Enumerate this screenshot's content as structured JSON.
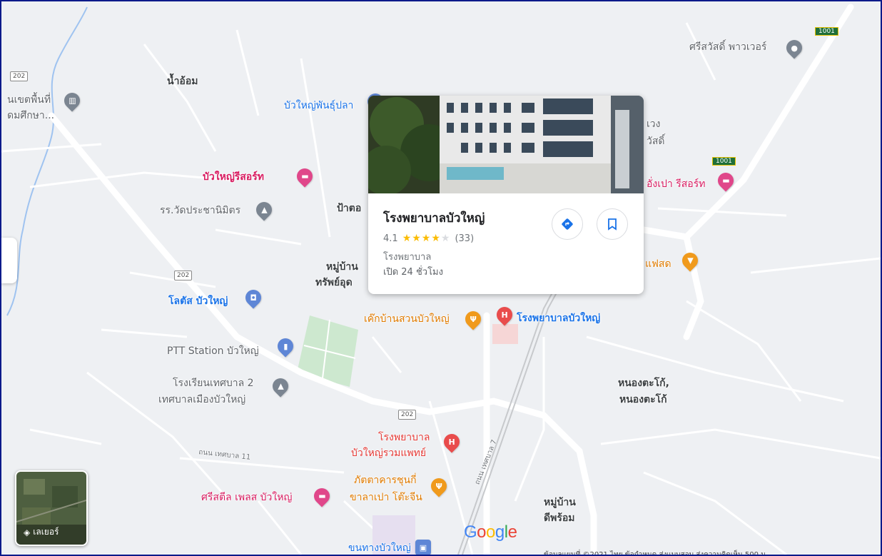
{
  "place_card": {
    "name": "โรงพยาบาลบัวใหญ่",
    "rating": "4.1",
    "rating_value": 4.1,
    "review_count": "(33)",
    "category": "โรงพยาบาล",
    "hours": "เปิด 24 ชั่วโมง",
    "directions_icon": "directions-icon",
    "save_icon": "bookmark-icon"
  },
  "labels": {
    "namom": "น้ำอ้อม",
    "sri_power": "ศรีสวัสดิ์ พาวเวอร์",
    "bua_yai_fish": "บัวใหญ่พันธุ์ปลา",
    "museum_line1": "นเขตพื้นที่",
    "museum_line2": "ดมศึกษา...",
    "resort": "บัวใหญ่รีสอร์ท",
    "school": "รร.วัดประชานิมิตร",
    "pata": "ป้าตอ",
    "village1_line1": "หมู่บ้าน",
    "village1_line2": "ทรัพย์อุด",
    "lotus": "โลตัส บัวใหญ่",
    "ptt": "PTT Station บัวใหญ่",
    "muni_school_line1": "โรงเรียนเทศบาล 2",
    "muni_school_line2": "เทศบาลเมืองบัวใหญ่",
    "suan_food": "เค๊กบ้านสวนบัวใหญ่",
    "hospital_map": "โรงพยาบาลบัวใหญ่",
    "hosp2_line1": "โรงพยาบาล",
    "hosp2_line2": "บัวใหญ่รวมแพทย์",
    "road_thesaban11": "ถนน เทศบาล 11",
    "restaurant_line1": "ภัตตาคารชุนกี่",
    "restaurant_line2": "ขาลาเปา โต๊ะจีน",
    "srisatin": "ศรีสตีล เพลส บัวใหญ่",
    "bus": "ขนทางบัวใหญ่",
    "village2_line1": "หมู่บ้าน",
    "village2_line2": "ดีพร้อม",
    "nongtako_line1": "หนองตะโก้,",
    "nongtako_line2": "หนองตะโก้",
    "aungpao": "อั่งเปา รีสอร์ท",
    "cafe": "แฟสด",
    "guang_line1": "เวง",
    "guang_line2": "วัสดิ์",
    "road_thesaban7": "ถนน เทศบาล 7"
  },
  "shields": {
    "r202_a": "202",
    "r202_b": "202",
    "r202_c": "202",
    "h1001_a": "1001",
    "h1001_b": "1001"
  },
  "layer_button": {
    "label": "เลเยอร์"
  },
  "google_logo": [
    "G",
    "o",
    "o",
    "g",
    "l",
    "e"
  ],
  "attribution": "ข้อมูลแผนที่ ©2021   ไทย   ข้อกำหนด   ส่งแบบสอบ   ส่งความคิดเห็น   500 ม."
}
